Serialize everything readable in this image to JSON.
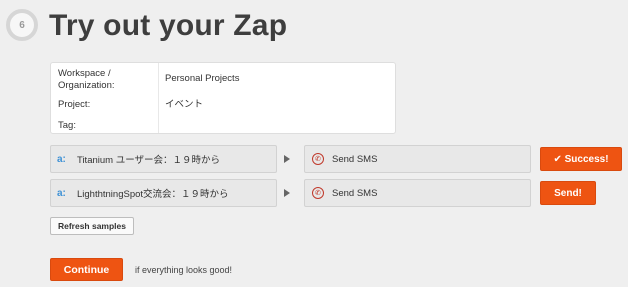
{
  "header": {
    "step_number": "6",
    "title": "Try out your Zap"
  },
  "info": {
    "workspace_label": "Workspace /\nOrganization:",
    "workspace_value": "Personal Projects",
    "project_label": "Project:",
    "project_value": "イベント",
    "tag_label": "Tag:",
    "tag_value": ""
  },
  "rows": [
    {
      "trigger_text": "Titanium ユーザー会：１９時から",
      "action_text": "Send SMS",
      "button_label": "✔ Success!"
    },
    {
      "trigger_text": "LighthtningSpot交流会：１９時から",
      "action_text": "Send SMS",
      "button_label": "Send!"
    }
  ],
  "icons": {
    "trigger_icon": "atnd-icon",
    "action_icon": "sms-icon",
    "arrow_icon": "arrow-right-icon"
  },
  "refresh_label": "Refresh samples",
  "continue": {
    "button_label": "Continue",
    "note": "if everything looks good!"
  },
  "colors": {
    "accent": "#ee5412",
    "background": "#efefef",
    "title": "#3e3e3e"
  }
}
